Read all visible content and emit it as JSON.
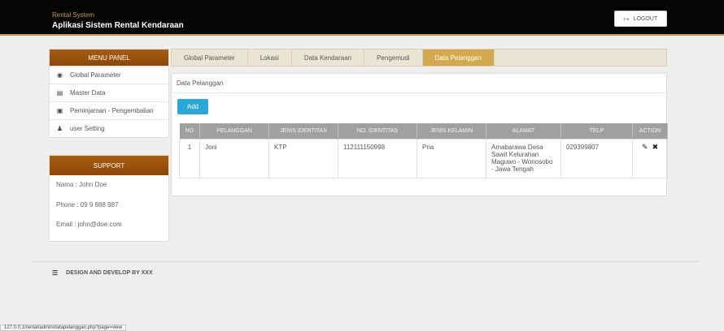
{
  "header": {
    "brand_small": "Rental System",
    "brand_title": "Aplikasi Sistem Rental Kendaraan",
    "logout_label": "LOGOUT",
    "logout_icon": "sign-out-icon"
  },
  "menu_panel": {
    "title": "MENU PANEL",
    "items": [
      {
        "label": "Global Parameter",
        "icon": "globe-icon"
      },
      {
        "label": "Master Data",
        "icon": "database-icon"
      },
      {
        "label": "Peminjaman - Pengembalian",
        "icon": "document-icon"
      },
      {
        "label": "user Setting",
        "icon": "user-icon"
      }
    ]
  },
  "support": {
    "title": "SUPPORT",
    "name": "Nama : John Doe",
    "phone": "Phone : 09 9 888 987",
    "email": "Email : john@doe.com"
  },
  "tabs": [
    {
      "label": "Global Parameter",
      "active": false
    },
    {
      "label": "Lokasi",
      "active": false
    },
    {
      "label": "Data Kendaraan",
      "active": false
    },
    {
      "label": "Pengemudi",
      "active": false
    },
    {
      "label": "Data Pelanggan",
      "active": true
    }
  ],
  "main": {
    "title": "Data Pelanggan",
    "add_label": "Add",
    "columns": [
      "NO",
      "PELANGGAN",
      "JENIS IDENTITAS",
      "NO. IDENTITAS",
      "JENIS KELAMIN",
      "ALAMAT",
      "TELP",
      "ACTION"
    ],
    "rows": [
      {
        "no": "1",
        "pelanggan": "Joni",
        "jenis_identitas": "KTP",
        "no_identitas": "112111150998",
        "jenis_kelamin": "Pria",
        "alamat": "Amabarawa Desa Sawit Kelurahan Maguwo - Wonosobo - Jawa Tengah",
        "telp": "029399807",
        "actions": [
          "edit-icon",
          "delete-icon"
        ]
      }
    ]
  },
  "footer": {
    "text": "DESIGN AND DEVELOP BY XXX",
    "icon": "menu-icon"
  },
  "status_url": "127.0.0.1/rental/admin/datapelanggan.php?page=view",
  "colors": {
    "topbar": "#050505",
    "accent_gold": "#c69a3a",
    "panel_header": "#8a4706",
    "active_tab": "#d4a94d",
    "add_button": "#2aa8d8",
    "table_header": "#a0a0a0"
  }
}
